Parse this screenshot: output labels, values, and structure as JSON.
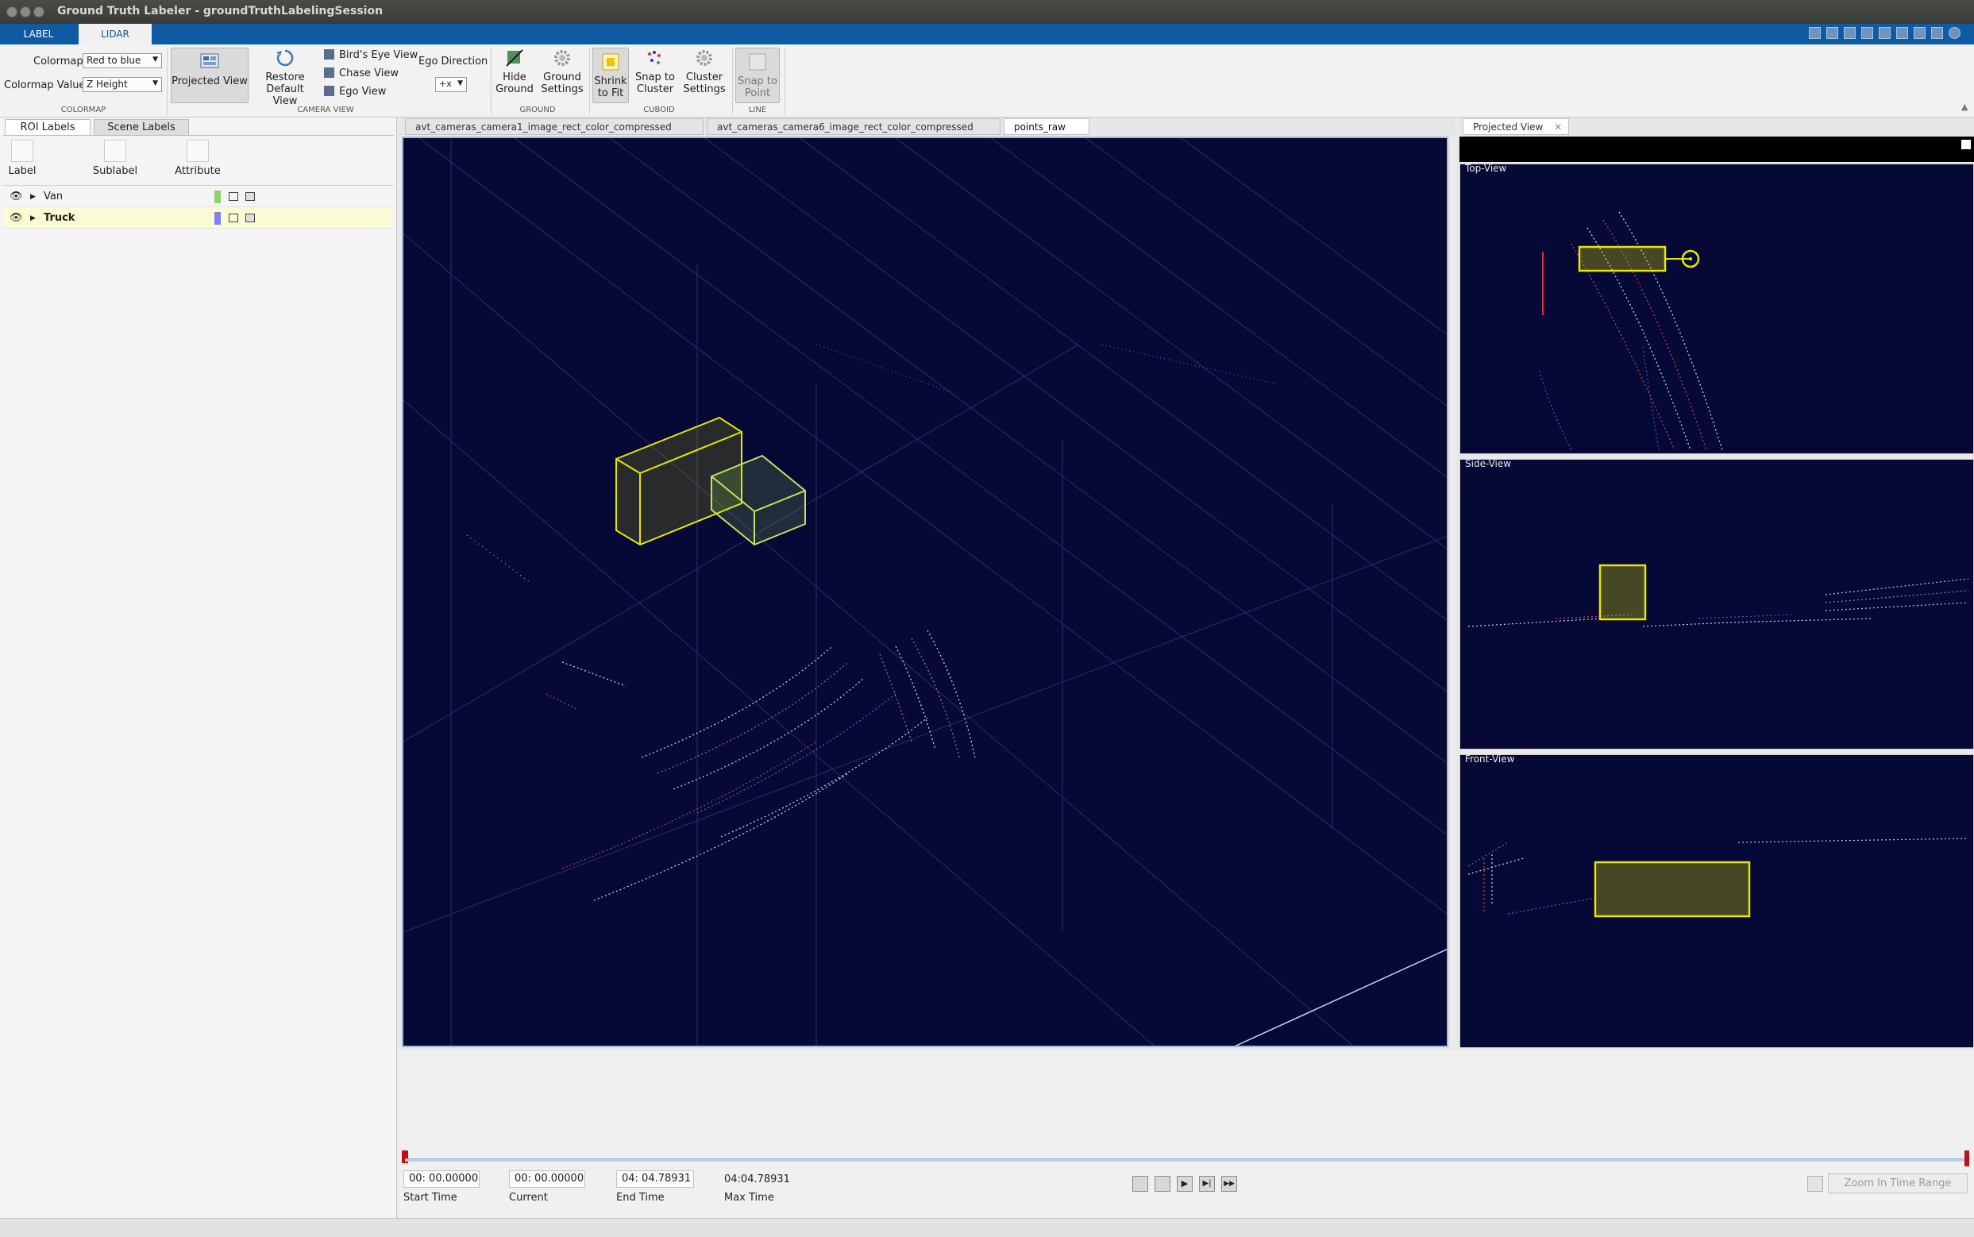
{
  "window": {
    "title": "Ground Truth Labeler - groundTruthLabelingSession"
  },
  "tabs": [
    {
      "label": "LABEL"
    },
    {
      "label": "LIDAR"
    }
  ],
  "toolstrip": {
    "colormap": {
      "label": "Colormap",
      "value": "Red to blue",
      "value_label": "Colormap Value",
      "value_value": "Z Height",
      "section": "COLORMAP"
    },
    "camera_view": {
      "projected_view": "Projected View",
      "restore_line1": "Restore",
      "restore_line2": "Default View",
      "birds_eye": "Bird's Eye View",
      "chase": "Chase View",
      "ego": "Ego View",
      "ego_direction": "Ego Direction",
      "ego_direction_value": "+x",
      "section": "CAMERA VIEW"
    },
    "ground": {
      "hide_line1": "Hide",
      "hide_line2": "Ground",
      "settings_line1": "Ground",
      "settings_line2": "Settings",
      "section": "GROUND"
    },
    "cuboid": {
      "shrink_line1": "Shrink",
      "shrink_line2": "to Fit",
      "snap_line1": "Snap to",
      "snap_line2": "Cluster",
      "cluster_line1": "Cluster",
      "cluster_line2": "Settings",
      "section": "CUBOID"
    },
    "line": {
      "snap_line1": "Snap to",
      "snap_line2": "Point",
      "section": "LINE"
    }
  },
  "left_panel": {
    "tabs": [
      "ROI Labels",
      "Scene Labels"
    ],
    "buttons": {
      "label": "Label",
      "sublabel": "Sublabel",
      "attribute": "Attribute"
    },
    "labels": [
      {
        "name": "Van",
        "color": "#8fd16a"
      },
      {
        "name": "Truck",
        "color": "#7f7fff"
      }
    ]
  },
  "doc_tabs": [
    "avt_cameras_camera1_image_rect_color_compressed",
    "avt_cameras_camera6_image_rect_color_compressed",
    "points_raw"
  ],
  "right_panel": {
    "tab": "Projected View",
    "views": [
      "Top-View",
      "Side-View",
      "Front-View"
    ]
  },
  "playback": {
    "start_time": "00: 00.00000",
    "start_caption": "Start Time",
    "current": "00: 00.00000",
    "current_caption": "Current",
    "end_time": "04: 04.78931",
    "end_caption": "End Time",
    "max_time": "04:04.78931",
    "max_caption": "Max Time",
    "zoom_button": "Zoom In Time Range"
  },
  "colors": {
    "accent": "#0e5aa3",
    "scene_bg": "#060836",
    "cuboid": "#e8e800"
  }
}
